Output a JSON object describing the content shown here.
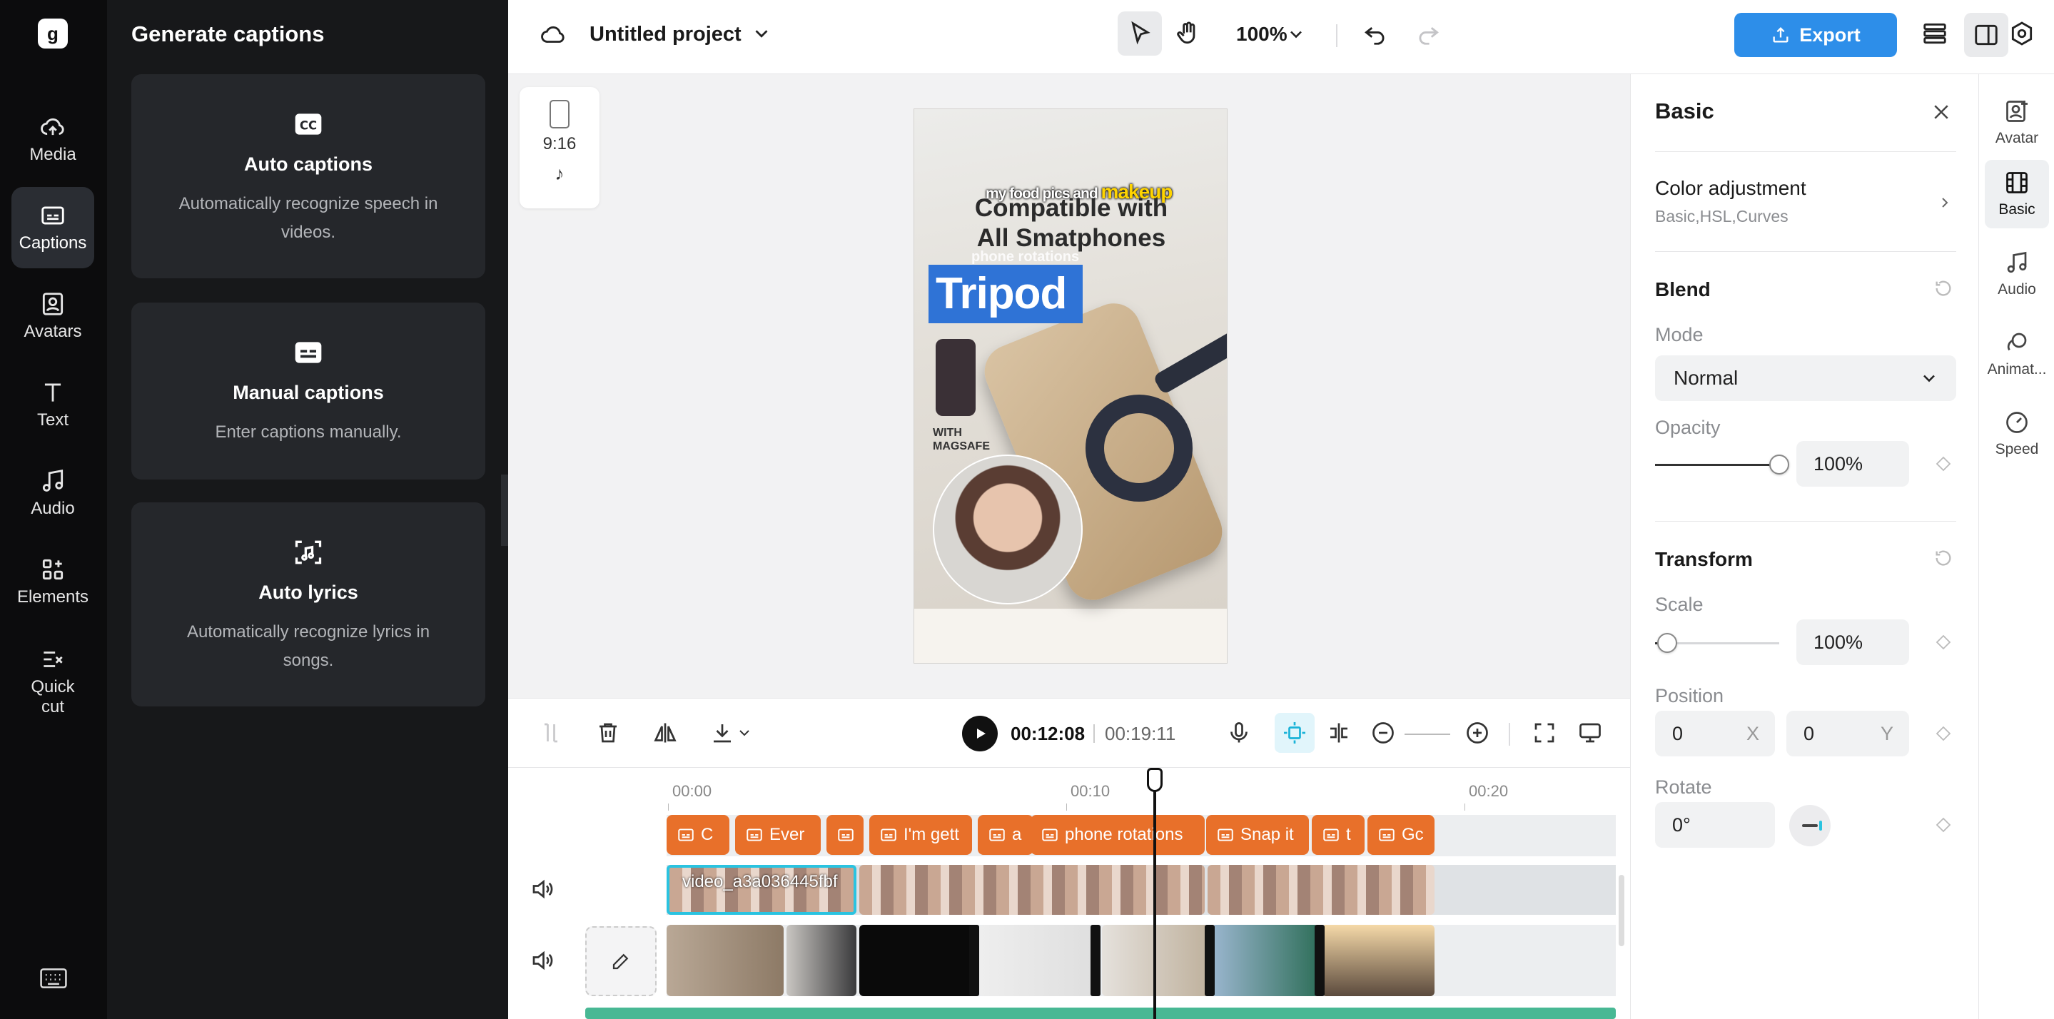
{
  "left_rail": {
    "items": [
      {
        "label": "Media"
      },
      {
        "label": "Captions"
      },
      {
        "label": "Avatars"
      },
      {
        "label": "Text"
      },
      {
        "label": "Audio"
      },
      {
        "label": "Elements"
      },
      {
        "label": "Quick cut"
      }
    ],
    "active": "Captions",
    "logo_glyph": "g"
  },
  "captions_panel": {
    "title": "Generate captions",
    "cards": [
      {
        "icon": "cc-icon",
        "title": "Auto captions",
        "description": "Automatically recognize speech in videos."
      },
      {
        "icon": "subtitle-icon",
        "title": "Manual captions",
        "description": "Enter captions manually."
      },
      {
        "icon": "music-scan-icon",
        "title": "Auto lyrics",
        "description": "Automatically recognize lyrics in songs."
      }
    ]
  },
  "topbar": {
    "project_title": "Untitled project",
    "zoom": "100%",
    "export_label": "Export",
    "accent_color": "#2d8ee9"
  },
  "canvas": {
    "aspect_ratio": "9:16",
    "preview": {
      "tagline": "my food pics and",
      "tagline_highlight": "makeup",
      "headline_1": "Compatible with",
      "headline_2": "All Smatphones",
      "subtitle": "phone rotations",
      "caption_word": "Tripod",
      "magsafe_1": "WITH",
      "magsafe_2": "MAGSAFE"
    }
  },
  "properties": {
    "title": "Basic",
    "color_adjustment": {
      "title": "Color adjustment",
      "subtitle": "Basic,HSL,Curves"
    },
    "blend": {
      "title": "Blend",
      "mode_label": "Mode",
      "mode_value": "Normal",
      "opacity_label": "Opacity",
      "opacity_value": "100%",
      "opacity_fraction": 1.0
    },
    "transform": {
      "title": "Transform",
      "scale_label": "Scale",
      "scale_value": "100%",
      "scale_fraction": 0.0,
      "position_label": "Position",
      "position_x": "0",
      "position_y": "0",
      "x_axis": "X",
      "y_axis": "Y",
      "rotate_label": "Rotate",
      "rotate_value": "0°"
    }
  },
  "right_rail": {
    "items": [
      {
        "label": "Avatar"
      },
      {
        "label": "Basic"
      },
      {
        "label": "Audio"
      },
      {
        "label": "Animat..."
      },
      {
        "label": "Speed"
      }
    ],
    "active": "Basic"
  },
  "timeline": {
    "current_time": "00:12:08",
    "total_time": "00:19:11",
    "ticks": [
      "00:00",
      "00:10",
      "00:20"
    ],
    "caption_clips": [
      "C",
      "Ever",
      "",
      "I'm gett",
      "a",
      "phone rotations",
      "Snap it",
      "t",
      "Gc"
    ],
    "video_clip_name": "video_a3a036445fbf",
    "caption_color": "#e8702a"
  }
}
